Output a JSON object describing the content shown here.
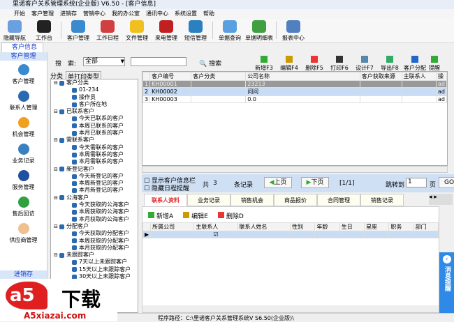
{
  "window": {
    "title": "里诺客户关系管理系统(企业版) V6.50 - [客户信息]"
  },
  "menu": [
    "开始",
    "客户管理",
    "进销存",
    "营销中心",
    "我的办公室",
    "通讯中心",
    "系统设置",
    "帮助"
  ],
  "toolbar": [
    {
      "label": "隐藏导航",
      "icon": "butterfly-icon",
      "color": "#6aa0e0"
    },
    {
      "label": "工作台",
      "icon": "dashboard-icon",
      "color": "#222222"
    },
    {
      "label": "客户管理",
      "icon": "users-icon",
      "color": "#3a8ad0"
    },
    {
      "label": "工作日程",
      "icon": "calendar-icon",
      "color": "#d04040"
    },
    {
      "label": "文件管理",
      "icon": "folder-icon",
      "color": "#f0c020"
    },
    {
      "label": "来电管理",
      "icon": "phone-icon",
      "color": "#c02020"
    },
    {
      "label": "短信管理",
      "icon": "mail-icon",
      "color": "#2a80c0"
    },
    {
      "label": "单据查询",
      "icon": "search-icon",
      "color": "#5aa0e0"
    },
    {
      "label": "单据明细表",
      "icon": "bar-chart-icon",
      "color": "#40a040"
    },
    {
      "label": "报表中心",
      "icon": "report-icon",
      "color": "#5080c0"
    }
  ],
  "doc_tab": "客户信息",
  "sidebar": {
    "header": "客户管理",
    "items": [
      {
        "label": "客户管理",
        "color": "#3a8ad0"
      },
      {
        "label": "联系人管理",
        "color": "#2a6ab0"
      },
      {
        "label": "机会管理",
        "color": "#f0a020"
      },
      {
        "label": "业务记录",
        "color": "#3a80c0"
      },
      {
        "label": "服务管理",
        "color": "#2050a0"
      },
      {
        "label": "售后回访",
        "color": "#30a040"
      },
      {
        "label": "供应商管理",
        "color": "#f0c090"
      }
    ],
    "footer": "进销存"
  },
  "search": {
    "label": "搜　索:",
    "scope": "全部",
    "value": "",
    "button": "搜索"
  },
  "actions": [
    "新增F3",
    "编辑F4",
    "删除F5",
    "打印F6",
    "设计F7",
    "导出F8",
    "客户分配",
    "提醒"
  ],
  "tree_tabs": [
    "分类",
    "单打印类型"
  ],
  "tree": [
    {
      "t": "客户分类",
      "l": 0
    },
    {
      "t": "01-234",
      "l": 1
    },
    {
      "t": "操作员",
      "l": 1
    },
    {
      "t": "客户所在地",
      "l": 1
    },
    {
      "t": "已联系客户",
      "l": 0
    },
    {
      "t": "今天已联系的客户",
      "l": 1
    },
    {
      "t": "本周已联系的客户",
      "l": 1
    },
    {
      "t": "本月已联系的客户",
      "l": 1
    },
    {
      "t": "需联系客户",
      "l": 0
    },
    {
      "t": "今天需联系的客户",
      "l": 1
    },
    {
      "t": "本周需联系的客户",
      "l": 1
    },
    {
      "t": "本月需联系的客户",
      "l": 1
    },
    {
      "t": "新登记客户",
      "l": 0
    },
    {
      "t": "今天新登记的客户",
      "l": 1
    },
    {
      "t": "本周新登记的客户",
      "l": 1
    },
    {
      "t": "本月新登记的客户",
      "l": 1
    },
    {
      "t": "公海客户",
      "l": 0
    },
    {
      "t": "今天获取的公海客户",
      "l": 1
    },
    {
      "t": "本周获取的公海客户",
      "l": 1
    },
    {
      "t": "本月获取的公海客户",
      "l": 1
    },
    {
      "t": "分配客户",
      "l": 0
    },
    {
      "t": "今天获取的分配客户",
      "l": 1
    },
    {
      "t": "本周获取的分配客户",
      "l": 1
    },
    {
      "t": "本月获取的分配客户",
      "l": 1
    },
    {
      "t": "未跟踪客户",
      "l": 0
    },
    {
      "t": "7天以上未跟踪客户",
      "l": 1
    },
    {
      "t": "15天以上未跟踪客户",
      "l": 1
    },
    {
      "t": "30天以上未跟踪客户",
      "l": 1
    }
  ],
  "grid": {
    "columns": [
      "",
      "客户编号",
      "客户分类",
      "公司名称",
      "客户获取来源",
      "主联系人",
      "操"
    ],
    "rows": [
      [
        "1",
        "KH00001",
        "",
        "23213",
        "",
        "",
        "ad"
      ],
      [
        "2",
        "KH00002",
        "",
        "问问",
        "",
        "",
        "ad"
      ],
      [
        "3",
        "KH00003",
        "",
        "0.0",
        "",
        "",
        "ad"
      ]
    ]
  },
  "pager": {
    "show_info": "显示客户信息栏",
    "hide_schedule": "隐藏日程提醒",
    "total_prefix": "共",
    "total": "3",
    "total_suffix": "条记录",
    "prev": "上页",
    "next": "下页",
    "page": "[1/1]",
    "jump_label": "跳转到",
    "jump_value": "1",
    "page_unit": "页",
    "go": "GO"
  },
  "detail_tabs": [
    "联系人资料",
    "业务记录",
    "销售机会",
    "商品报价",
    "合同管理",
    "销售记录"
  ],
  "detail_actions": [
    "新增A",
    "编辑E",
    "删除D"
  ],
  "detail_columns": [
    "所属公司",
    "主联系人",
    "联系人姓名",
    "性别",
    "年龄",
    "生日",
    "星座",
    "职务",
    "部门"
  ],
  "message_panel": "消息提醒",
  "status": "程序路径：C:\\里诺客户关系管理系统V S6.50(企业版)\\",
  "watermark": {
    "brand": "A5下载",
    "url": "A5xiazai.com"
  }
}
